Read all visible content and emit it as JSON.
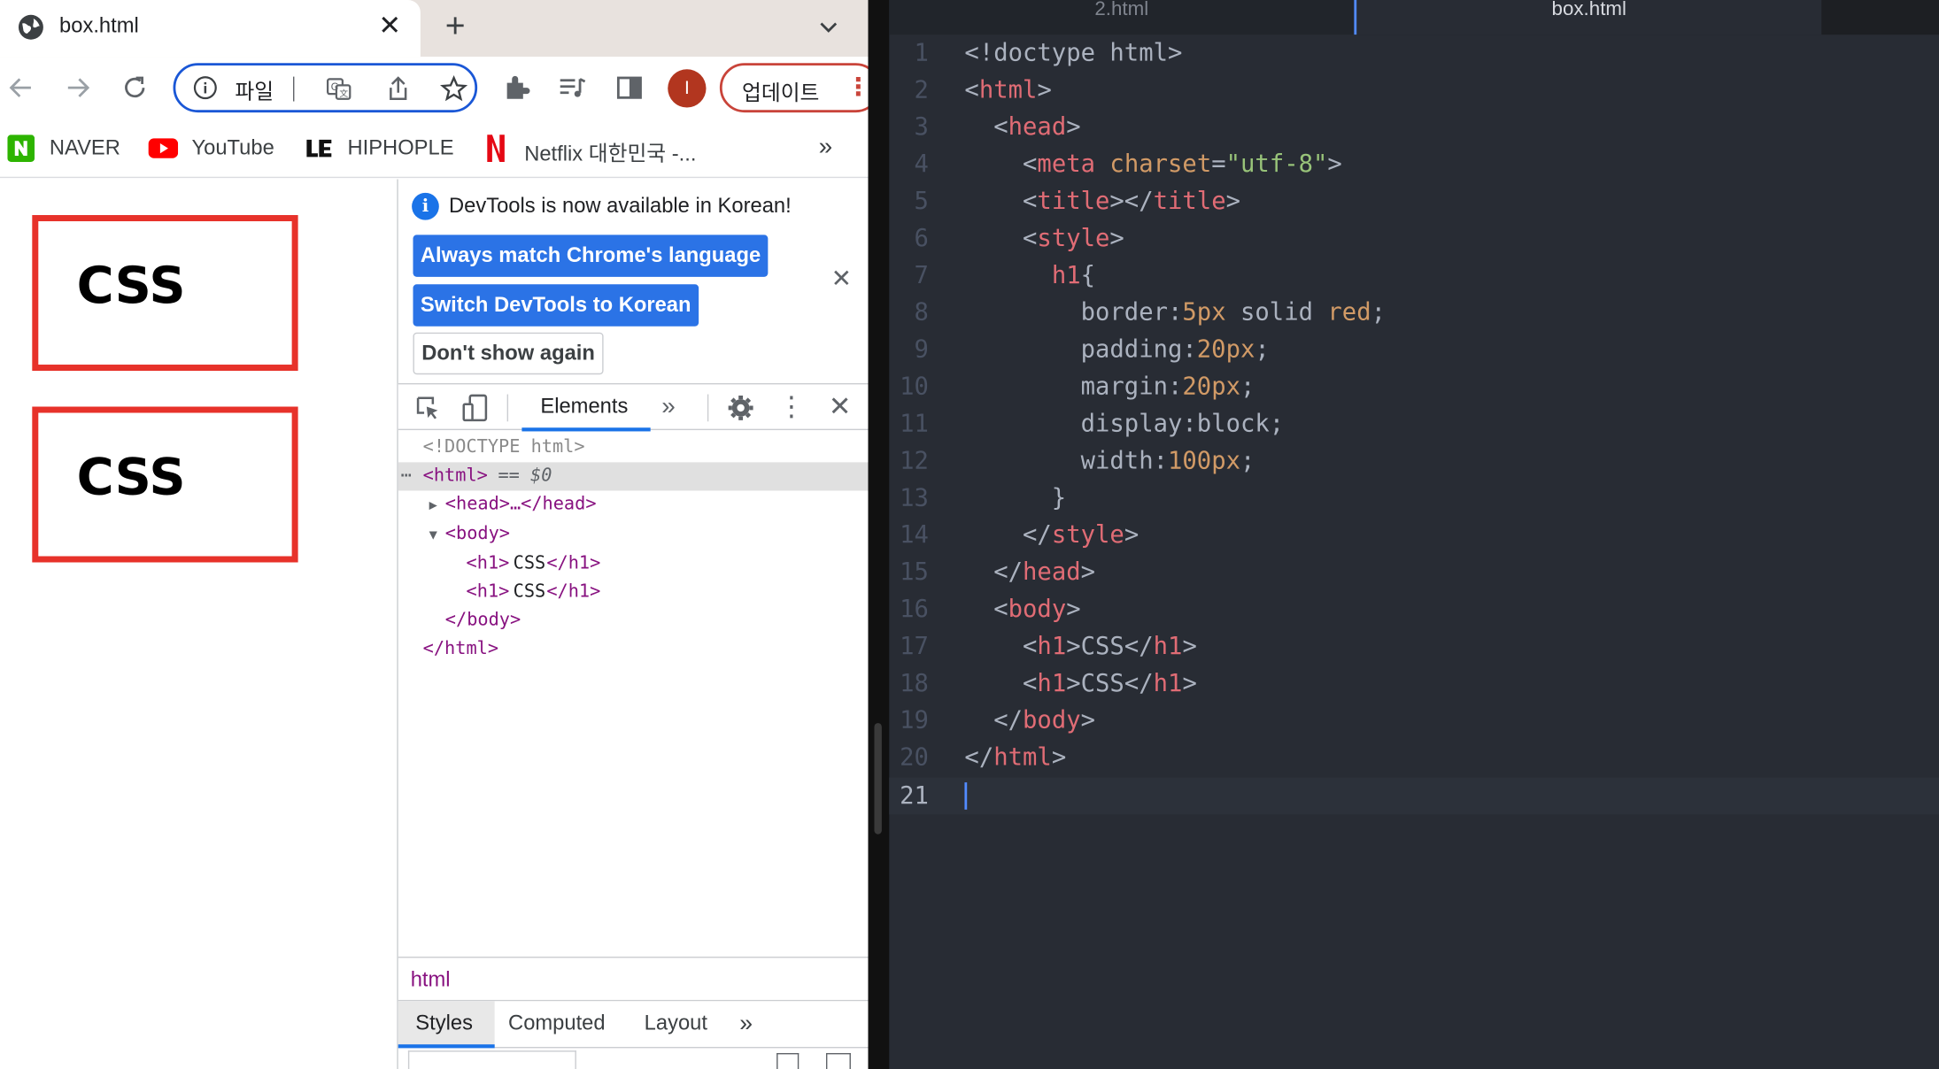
{
  "browser": {
    "tab_title": "box.html",
    "omnibox_label": "파일",
    "update_label": "업데이트",
    "avatar_letter": "I",
    "bookmarks": [
      {
        "label": "NAVER"
      },
      {
        "label": "YouTube"
      },
      {
        "label": "HIPHOPLE"
      },
      {
        "label": "Netflix 대한민국 -..."
      }
    ],
    "bookmarks_more": "»"
  },
  "page": {
    "headings": [
      "CSS",
      "CSS"
    ]
  },
  "devtools": {
    "info_text": "DevTools is now available in Korean!",
    "btn_match": "Always match Chrome's language",
    "btn_switch": "Switch DevTools to Korean",
    "btn_dont_show": "Don't show again",
    "tab_elements": "Elements",
    "dom": {
      "doctype": "<!DOCTYPE html>",
      "html_open": "<html>",
      "html_eq": " == $0",
      "head": "<head>…</head>",
      "body_open": "<body>",
      "h1_open": "<h1>",
      "h1_text": "CSS",
      "h1_close": "</h1>",
      "body_close": "</body>",
      "html_close": "</html>"
    },
    "breadcrumb": "html",
    "styles_tabs": [
      "Styles",
      "Computed",
      "Layout"
    ]
  },
  "editor": {
    "tabs": [
      "2.html",
      "box.html"
    ],
    "active_tab": 1,
    "line_numbers": [
      "1",
      "2",
      "3",
      "4",
      "5",
      "6",
      "7",
      "8",
      "9",
      "10",
      "11",
      "12",
      "13",
      "14",
      "15",
      "16",
      "17",
      "18",
      "19",
      "20",
      "21"
    ],
    "code": {
      "l1": "<!doctype html>",
      "l2_tag": "html",
      "l3_tag": "head",
      "l4_tag": "meta",
      "l4_attr": "charset",
      "l4_val": "\"utf-8\"",
      "l5_tag": "title",
      "l6_tag": "style",
      "l7_sel": "h1",
      "l8_prop": "border:",
      "l8_num": "5px",
      "l8_mid": " solid ",
      "l8_kw": "red",
      "l9_prop": "padding:",
      "l9_num": "20px",
      "l10_prop": "margin:",
      "l10_num": "20px",
      "l11_prop": "display:",
      "l11_val": "block;",
      "l12_prop": "width:",
      "l12_num": "100px",
      "l16_tag": "body",
      "l17_tag": "h1",
      "l17_text": "CSS"
    }
  },
  "colors": {
    "box_border": "#e7322a",
    "omnibox_border": "#1a57d6",
    "devtools_button": "#2b73e6",
    "editor_bg": "#282c34"
  }
}
